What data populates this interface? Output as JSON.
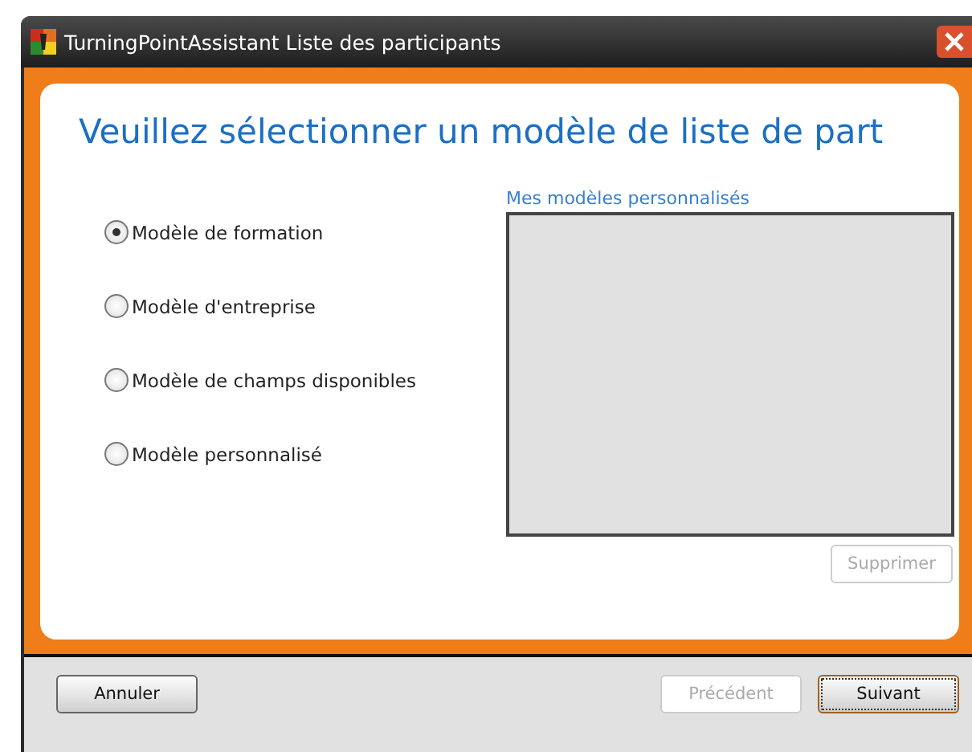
{
  "window": {
    "title": "TurningPointAssistant Liste des participants"
  },
  "heading": "Veuillez sélectionner un modèle de liste de part",
  "options": [
    {
      "label": "Modèle de formation",
      "selected": true
    },
    {
      "label": "Modèle d'entreprise",
      "selected": false
    },
    {
      "label": "Modèle de champs disponibles",
      "selected": false
    },
    {
      "label": "Modèle personnalisé",
      "selected": false
    }
  ],
  "custom_templates": {
    "label": "Mes modèles personnalisés",
    "delete_button": {
      "label": "Supprimer",
      "disabled": true
    }
  },
  "footer": {
    "buttons": [
      {
        "label": "Annuler",
        "disabled": false,
        "focused": false
      },
      {
        "label": "Précédent",
        "disabled": true,
        "focused": false
      },
      {
        "label": "Suivant",
        "disabled": false,
        "focused": true
      }
    ]
  }
}
